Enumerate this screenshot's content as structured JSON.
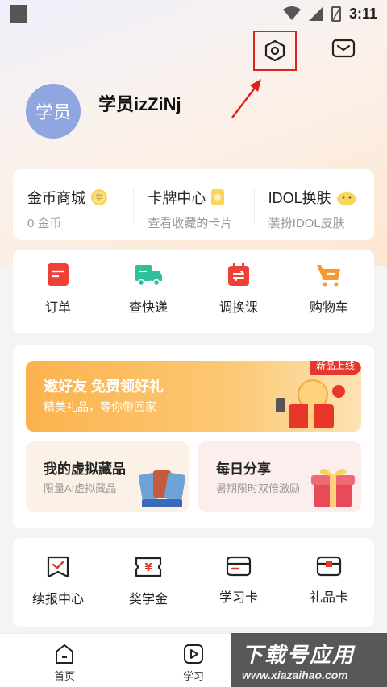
{
  "status_bar": {
    "time": "3:11"
  },
  "profile": {
    "avatar_text": "学员",
    "username": "学员izZiNj"
  },
  "wallet": [
    {
      "title": "金币商城",
      "subtitle": "0 金币",
      "badge_icon": "coin-icon"
    },
    {
      "title": "卡牌中心",
      "subtitle": "查看收藏的卡片",
      "badge_icon": "card-icon"
    },
    {
      "title": "IDOL换肤",
      "subtitle": "装扮IDOL皮肤",
      "badge_icon": "chick-icon"
    }
  ],
  "actions": [
    {
      "label": "订单",
      "icon": "order-icon",
      "color": "#ee4036"
    },
    {
      "label": "查快递",
      "icon": "truck-icon",
      "color": "#2fbf9a"
    },
    {
      "label": "调换课",
      "icon": "calendar-swap-icon",
      "color": "#ee4036"
    },
    {
      "label": "购物车",
      "icon": "cart-icon",
      "color": "#f69a2e"
    }
  ],
  "promo": {
    "banner_title": "邀好友 免费领好礼",
    "banner_subtitle": "精美礼品，等你带回家",
    "new_tag": "新品上线",
    "tiles": [
      {
        "title": "我的虚拟藏品",
        "subtitle": "限量AI虚拟藏品"
      },
      {
        "title": "每日分享",
        "subtitle": "暑期限时双倍激励"
      }
    ]
  },
  "services": [
    {
      "label": "续报中心",
      "icon": "renew-icon"
    },
    {
      "label": "奖学金",
      "icon": "scholarship-icon"
    },
    {
      "label": "学习卡",
      "icon": "study-card-icon"
    },
    {
      "label": "礼品卡",
      "icon": "gift-card-icon"
    }
  ],
  "bottom_nav": [
    {
      "label": "首页",
      "icon": "home-icon"
    },
    {
      "label": "学习",
      "icon": "play-icon"
    }
  ],
  "watermark": {
    "title": "下载号应用",
    "url": "www.xiazaihao.com"
  }
}
